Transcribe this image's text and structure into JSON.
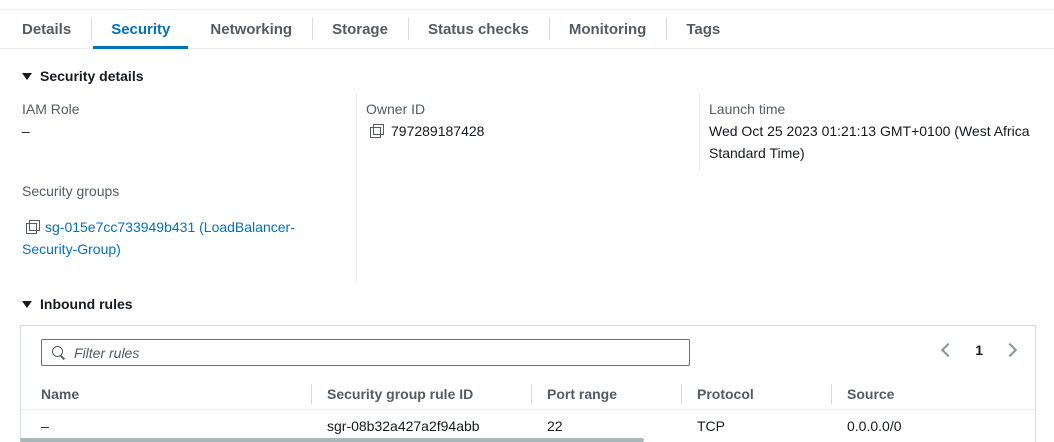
{
  "tabs": [
    {
      "label": "Details",
      "active": false
    },
    {
      "label": "Security",
      "active": true
    },
    {
      "label": "Networking",
      "active": false
    },
    {
      "label": "Storage",
      "active": false
    },
    {
      "label": "Status checks",
      "active": false
    },
    {
      "label": "Monitoring",
      "active": false
    },
    {
      "label": "Tags",
      "active": false
    }
  ],
  "security_details": {
    "title": "Security details",
    "iam_role_label": "IAM Role",
    "iam_role_value": "–",
    "owner_id_label": "Owner ID",
    "owner_id_value": "797289187428",
    "launch_time_label": "Launch time",
    "launch_time_value_line1": "Wed Oct 25 2023 01:21:13 GMT+0100 (West Africa",
    "launch_time_value_line2": "Standard Time)",
    "security_groups_label": "Security groups",
    "security_group_line1": "sg-015e7cc733949b431 (LoadBalancer-",
    "security_group_line2": "Security-Group)"
  },
  "inbound_rules": {
    "title": "Inbound rules",
    "filter_placeholder": "Filter rules",
    "page": "1",
    "columns": [
      "Name",
      "Security group rule ID",
      "Port range",
      "Protocol",
      "Source"
    ],
    "rows": [
      [
        "–",
        "sgr-08b32a427a2f94abb",
        "22",
        "TCP",
        "0.0.0.0/0"
      ]
    ]
  },
  "colors": {
    "accent": "#0073bb",
    "text": "#16191f",
    "muted": "#545b64"
  }
}
